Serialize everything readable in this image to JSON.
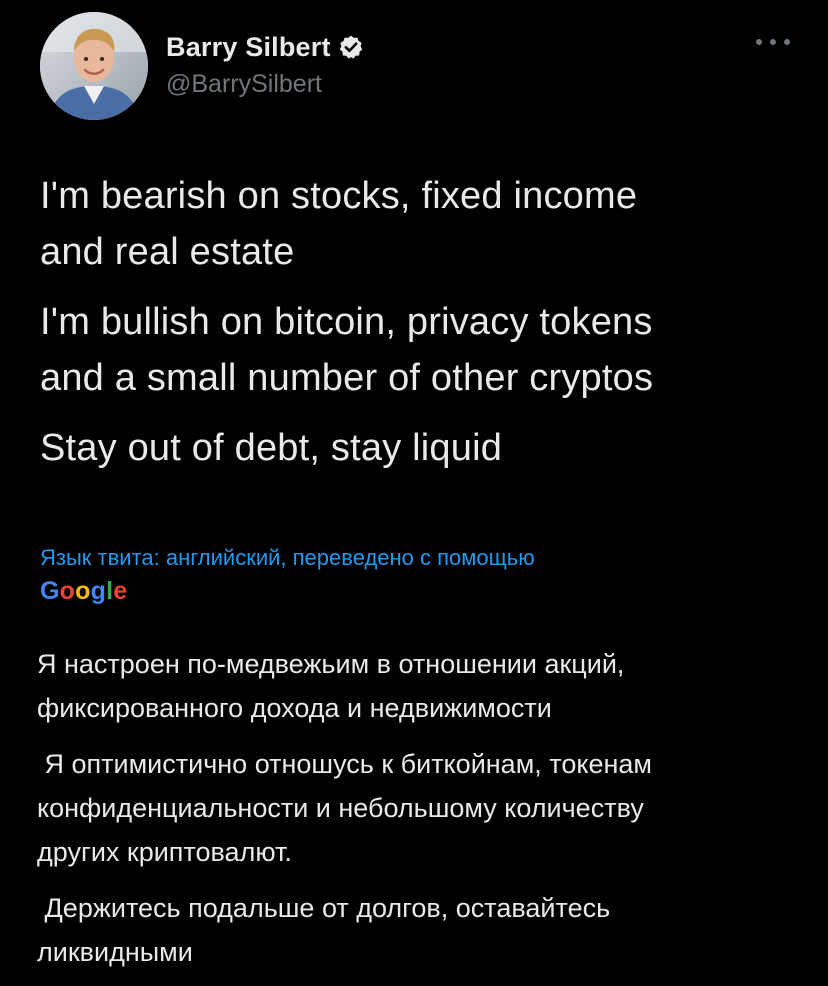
{
  "author": {
    "display_name": "Barry Silbert",
    "handle": "@BarrySilbert",
    "verified": true,
    "avatar_icon": "profile-photo"
  },
  "tweet": {
    "paragraphs": [
      "I'm bearish on stocks, fixed income\nand real estate",
      "I'm bullish on bitcoin, privacy tokens\nand a small number of other cryptos",
      "Stay out of debt, stay liquid"
    ]
  },
  "translation": {
    "label": "Язык твита: английский, переведено с помощью",
    "provider": {
      "letters": [
        "G",
        "o",
        "o",
        "g",
        "l",
        "e"
      ]
    },
    "paragraphs": [
      "Я настроен по-медвежьим в отношении акций,\nфиксированного дохода и недвижимости",
      " Я оптимистично отношусь к биткойнам, токенам\nконфиденциальности и небольшому количеству\nдругих криптовалют.",
      " Держитесь подальше от долгов, оставайтесь\nликвидными"
    ]
  },
  "colors": {
    "background": "#000000",
    "text": "#e7e9ea",
    "muted": "#71767b",
    "link": "#1d9bf0"
  }
}
